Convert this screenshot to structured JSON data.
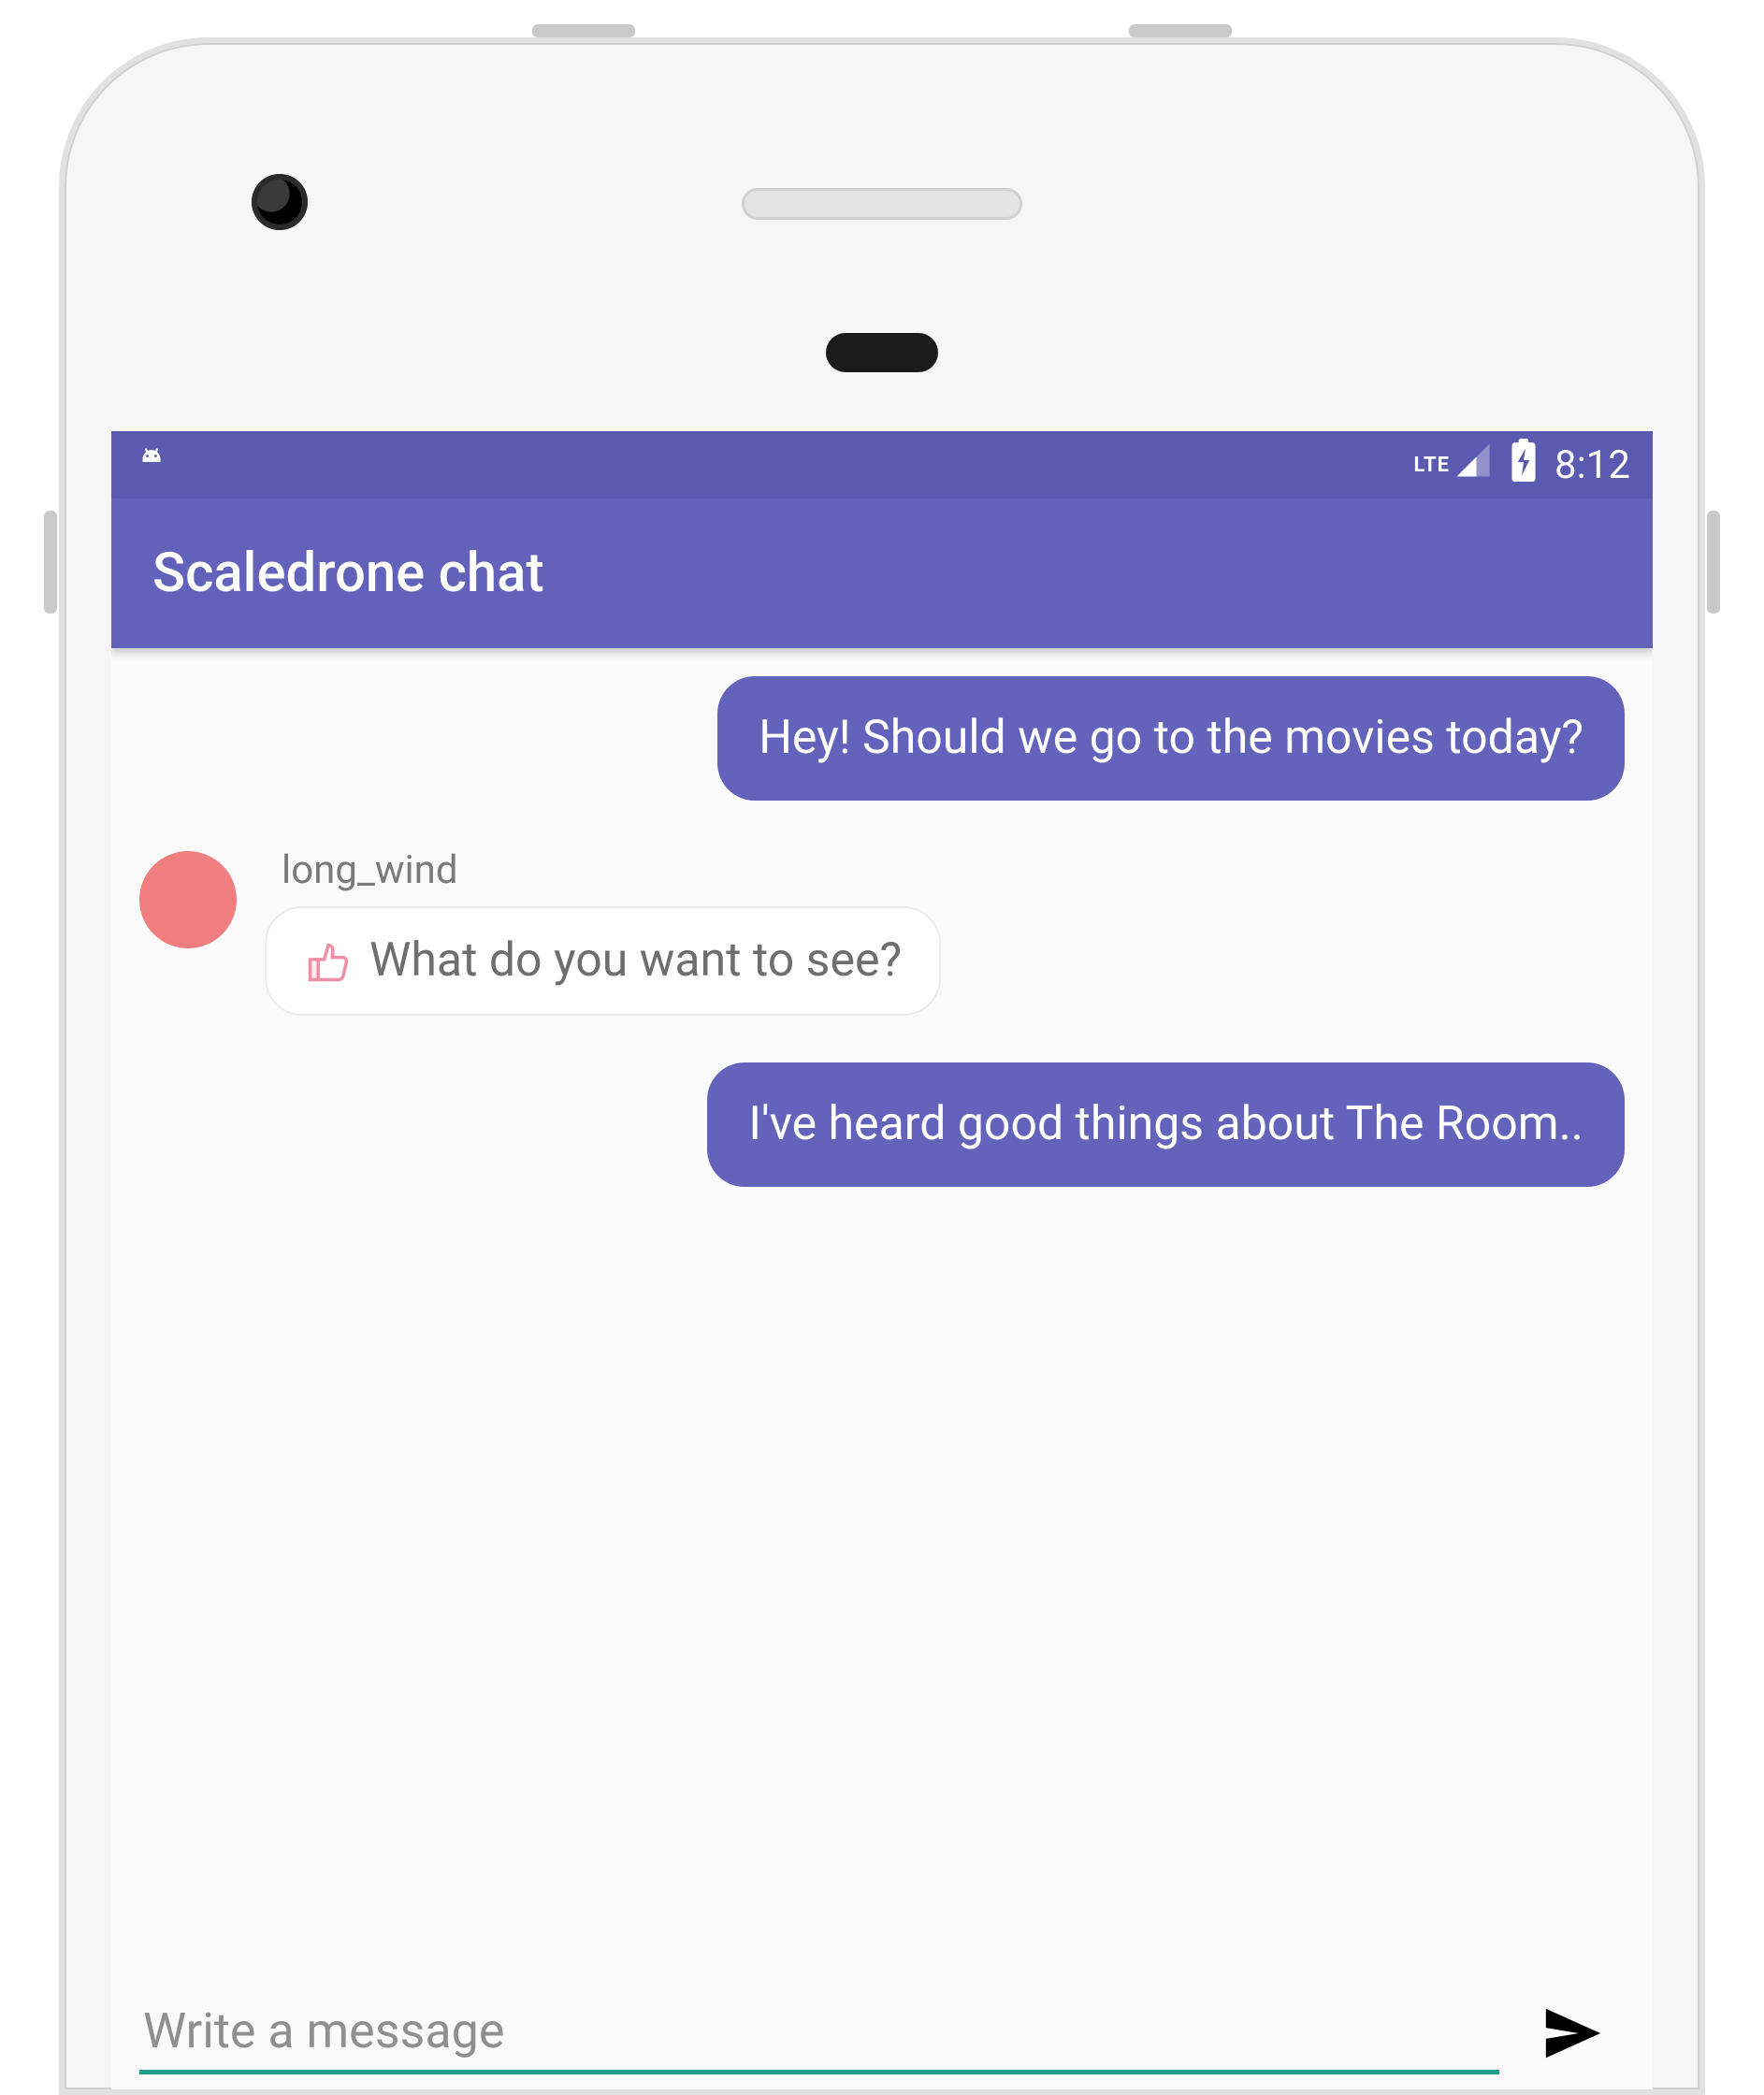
{
  "status": {
    "network_label": "LTE",
    "time": "8:12"
  },
  "appbar": {
    "title": "Scaledrone chat"
  },
  "colors": {
    "primary": "#6262ba",
    "primary_dark": "#5a5ab0",
    "bubble_mine": "#6363bb",
    "avatar": "#f07e7e",
    "accent_underline": "#1e9e8a"
  },
  "chat": {
    "messages": [
      {
        "type": "mine",
        "text": "Hey! Should we go to the movies today?"
      },
      {
        "type": "theirs",
        "sender": "long_wind",
        "icon": "thumbs-up-icon",
        "text": "What do you want to see?"
      },
      {
        "type": "mine",
        "text": "I've heard good things about The Room.."
      }
    ]
  },
  "compose": {
    "placeholder": "Write a message",
    "value": ""
  }
}
